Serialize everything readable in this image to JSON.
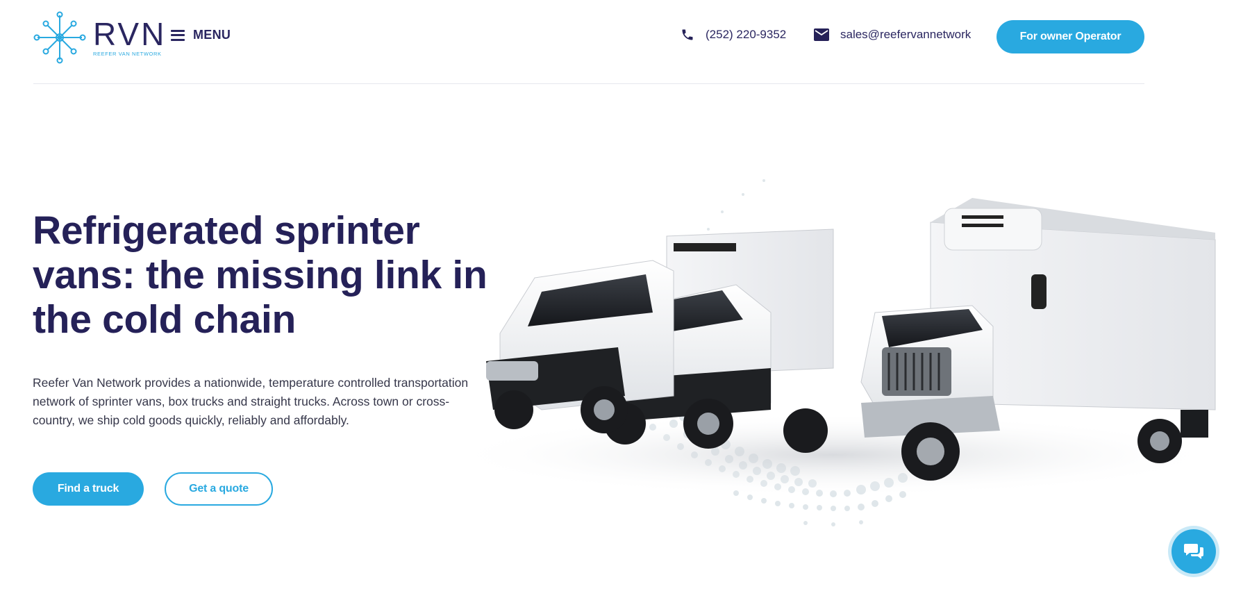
{
  "header": {
    "logo": {
      "main": "RVN",
      "sub": "REEFER VAN NETWORK"
    },
    "menu_label": "MENU",
    "phone": "(252) 220-9352",
    "email": "sales@reefervannetwork",
    "owner_button": "For owner Operator"
  },
  "hero": {
    "title": "Refrigerated sprinter vans: the missing link in the cold chain",
    "description": "Reefer Van Network provides a nationwide, temperature controlled transportation network of sprinter vans, box trucks and straight trucks. Across town or cross-country, we ship cold goods quickly, reliably and affordably.",
    "find_button": "Find a truck",
    "quote_button": "Get a quote"
  },
  "icons": {
    "logo": "network-star-icon",
    "menu": "hamburger-icon",
    "phone": "phone-icon",
    "email": "envelope-icon",
    "chat": "chat-bubbles-icon"
  },
  "colors": {
    "brand_navy": "#252158",
    "accent_blue": "#29a9e0",
    "text": "#36374a"
  }
}
